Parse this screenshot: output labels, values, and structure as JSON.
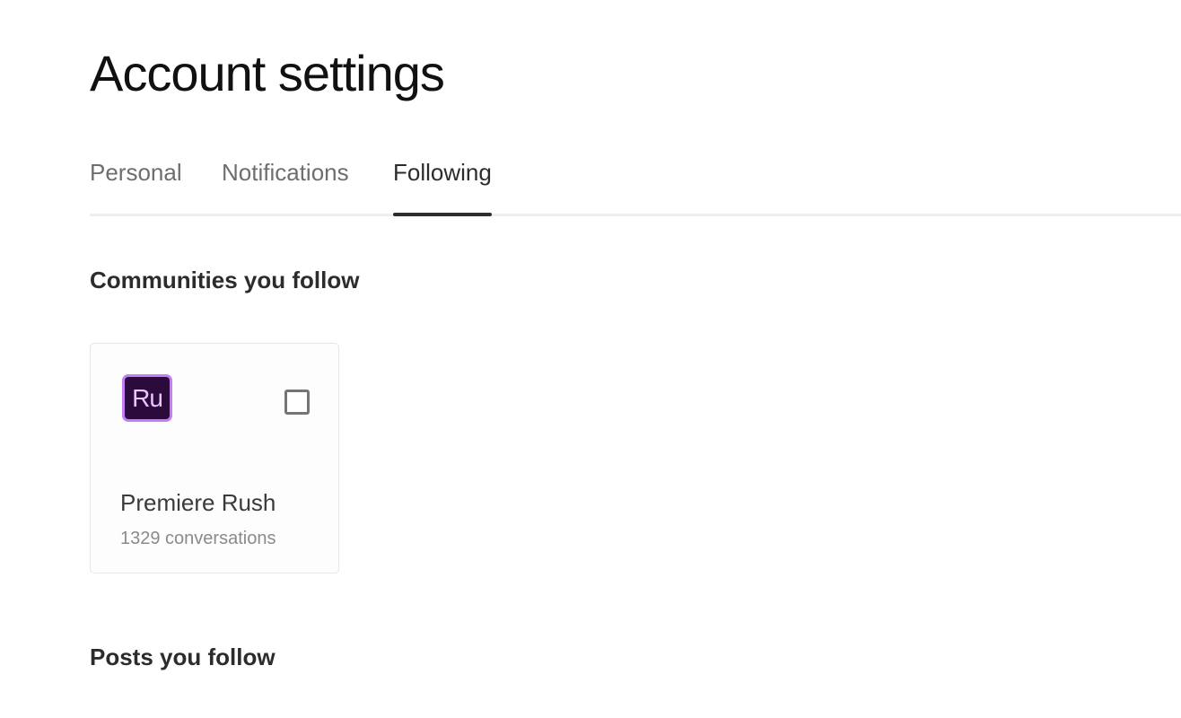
{
  "page": {
    "title": "Account settings"
  },
  "tabs": [
    {
      "label": "Personal",
      "selected": false
    },
    {
      "label": "Notifications",
      "selected": false
    },
    {
      "label": "Following",
      "selected": true
    }
  ],
  "sections": {
    "communities_heading": "Communities you follow",
    "posts_heading": "Posts you follow"
  },
  "communities": [
    {
      "name": "Premiere Rush",
      "conversations": "1329 conversations",
      "logo_text": "Ru",
      "logo_icon": "premiere-rush-icon",
      "followed_checkbox_checked": false
    }
  ],
  "colors": {
    "logo_background": "#2a0b3c",
    "logo_border": "#c27df7",
    "logo_text": "#e7c6ff",
    "active_tab_indicator": "#2c2c2c"
  }
}
